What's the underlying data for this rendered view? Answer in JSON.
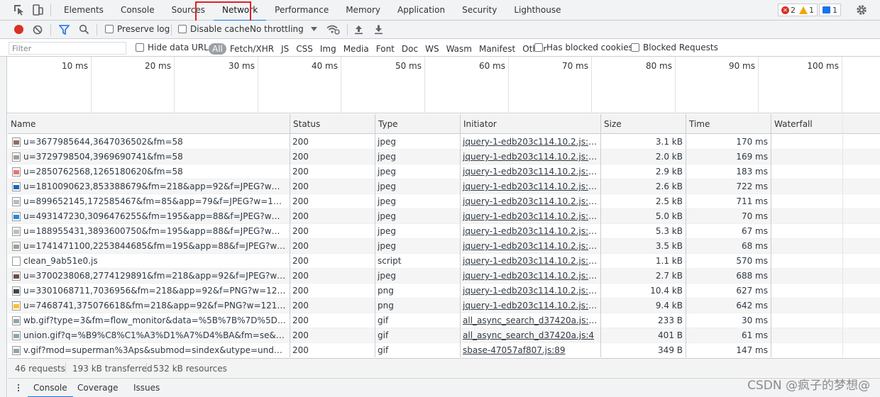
{
  "tabs": [
    {
      "label": "Elements"
    },
    {
      "label": "Console"
    },
    {
      "label": "Sources"
    },
    {
      "label": "Network"
    },
    {
      "label": "Performance"
    },
    {
      "label": "Memory"
    },
    {
      "label": "Application"
    },
    {
      "label": "Security"
    },
    {
      "label": "Lighthouse"
    }
  ],
  "active_tab": "Network",
  "counters": {
    "errors": "2",
    "warnings": "1",
    "messages": "1"
  },
  "toolbar": {
    "preserve_log": "Preserve log",
    "disable_cache": "Disable cache",
    "throttling": "No throttling"
  },
  "filter": {
    "placeholder": "Filter",
    "hide_data_urls": "Hide data URLs",
    "types": [
      "All",
      "Fetch/XHR",
      "JS",
      "CSS",
      "Img",
      "Media",
      "Font",
      "Doc",
      "WS",
      "Wasm",
      "Manifest",
      "Other"
    ],
    "has_blocked_cookies": "Has blocked cookies",
    "blocked_requests": "Blocked Requests"
  },
  "overview_ticks": [
    "10 ms",
    "20 ms",
    "30 ms",
    "40 ms",
    "50 ms",
    "60 ms",
    "70 ms",
    "80 ms",
    "90 ms",
    "100 ms"
  ],
  "columns": {
    "name": "Name",
    "status": "Status",
    "type": "Type",
    "initiator": "Initiator",
    "size": "Size",
    "time": "Time",
    "waterfall": "Waterfall"
  },
  "requests": [
    {
      "name": "u=3677985644,3647036502&fm=58",
      "status": "200",
      "type": "jpeg",
      "initiator": "jquery-1-edb203c114.10.2.js:198",
      "size": "3.1 kB",
      "time": "170 ms",
      "icon_color": "#8d6e63"
    },
    {
      "name": "u=3729798504,3969690741&fm=58",
      "status": "200",
      "type": "jpeg",
      "initiator": "jquery-1-edb203c114.10.2.js:198",
      "size": "2.0 kB",
      "time": "169 ms",
      "icon_color": "#9e9e9e"
    },
    {
      "name": "u=2850762568,1265180620&fm=58",
      "status": "200",
      "type": "jpeg",
      "initiator": "jquery-1-edb203c114.10.2.js:198",
      "size": "2.9 kB",
      "time": "183 ms",
      "icon_color": "#e57373"
    },
    {
      "name": "u=1810090623,853388679&fm=218&app=92&f=JPEG?w=121&h=...",
      "status": "200",
      "type": "jpeg",
      "initiator": "jquery-1-edb203c114.10.2.js:198",
      "size": "2.6 kB",
      "time": "722 ms",
      "icon_color": "#1565c0"
    },
    {
      "name": "u=899652145,172585467&fm=85&app=79&f=JPEG?w=121&h=75...",
      "status": "200",
      "type": "jpeg",
      "initiator": "jquery-1-edb203c114.10.2.js:198",
      "size": "2.5 kB",
      "time": "711 ms",
      "icon_color": "#b0bec5"
    },
    {
      "name": "u=493147230,3096476255&fm=195&app=88&f=JPEG?w=200&h=...",
      "status": "200",
      "type": "jpeg",
      "initiator": "jquery-1-edb203c114.10.2.js:198",
      "size": "5.0 kB",
      "time": "70 ms",
      "icon_color": "#1e88e5"
    },
    {
      "name": "u=188955431,3893600750&fm=195&app=88&f=JPEG?w=200&h=...",
      "status": "200",
      "type": "jpeg",
      "initiator": "jquery-1-edb203c114.10.2.js:198",
      "size": "5.3 kB",
      "time": "67 ms",
      "icon_color": "#bdbdbd"
    },
    {
      "name": "u=1741471100,2253844685&fm=195&app=88&f=JPEG?w=200&h...",
      "status": "200",
      "type": "jpeg",
      "initiator": "jquery-1-edb203c114.10.2.js:198",
      "size": "3.5 kB",
      "time": "68 ms",
      "icon_color": "#9e9e9e"
    },
    {
      "name": "clean_9ab51e0.js",
      "status": "200",
      "type": "script",
      "initiator": "jquery-1-edb203c114.10.2.js:255",
      "size": "1.1 kB",
      "time": "570 ms",
      "icon_color": "#ffffff"
    },
    {
      "name": "u=3700238068,2774129891&fm=218&app=92&f=JPEG?w=121&h...",
      "status": "200",
      "type": "jpeg",
      "initiator": "jquery-1-edb203c114.10.2.js:198",
      "size": "2.7 kB",
      "time": "688 ms",
      "icon_color": "#6d4c41"
    },
    {
      "name": "u=3301068711,7036956&fm=218&app=92&f=PNG?w=121&h=75...",
      "status": "200",
      "type": "png",
      "initiator": "jquery-1-edb203c114.10.2.js:198",
      "size": "10.4 kB",
      "time": "627 ms",
      "icon_color": "#37474f"
    },
    {
      "name": "u=7468741,375076618&fm=218&app=92&f=PNG?w=121&h=75&...",
      "status": "200",
      "type": "png",
      "initiator": "jquery-1-edb203c114.10.2.js:198",
      "size": "9.4 kB",
      "time": "642 ms",
      "icon_color": "#fbc02d"
    },
    {
      "name": "wb.gif?type=3&fm=flow_monitor&data=%5B%7B%7D%5D&q=...",
      "status": "200",
      "type": "gif",
      "initiator": "all_async_search_d37420a.js:318",
      "size": "233 B",
      "time": "30 ms",
      "icon_color": "#90a4ae"
    },
    {
      "name": "union.gif?q=%B9%C8%C1%A3%D1%A7%D4%BA&fm=se&T=16340...",
      "status": "200",
      "type": "gif",
      "initiator": "all_async_search_d37420a.js:4",
      "size": "401 B",
      "time": "61 ms",
      "icon_color": "#90a4ae"
    },
    {
      "name": "v.gif?mod=superman%3Aps&submod=sindex&utype=undefi...2%2...",
      "status": "200",
      "type": "gif",
      "initiator": "sbase-47057af807.js:89",
      "size": "349 B",
      "time": "147 ms",
      "icon_color": "#90a4ae"
    }
  ],
  "summary": {
    "requests": "46 requests",
    "transferred": "193 kB transferred",
    "resources": "532 kB resources"
  },
  "drawer": {
    "tabs": [
      "Console",
      "Coverage",
      "Issues"
    ]
  },
  "watermark": "CSDN @疯子的梦想@"
}
